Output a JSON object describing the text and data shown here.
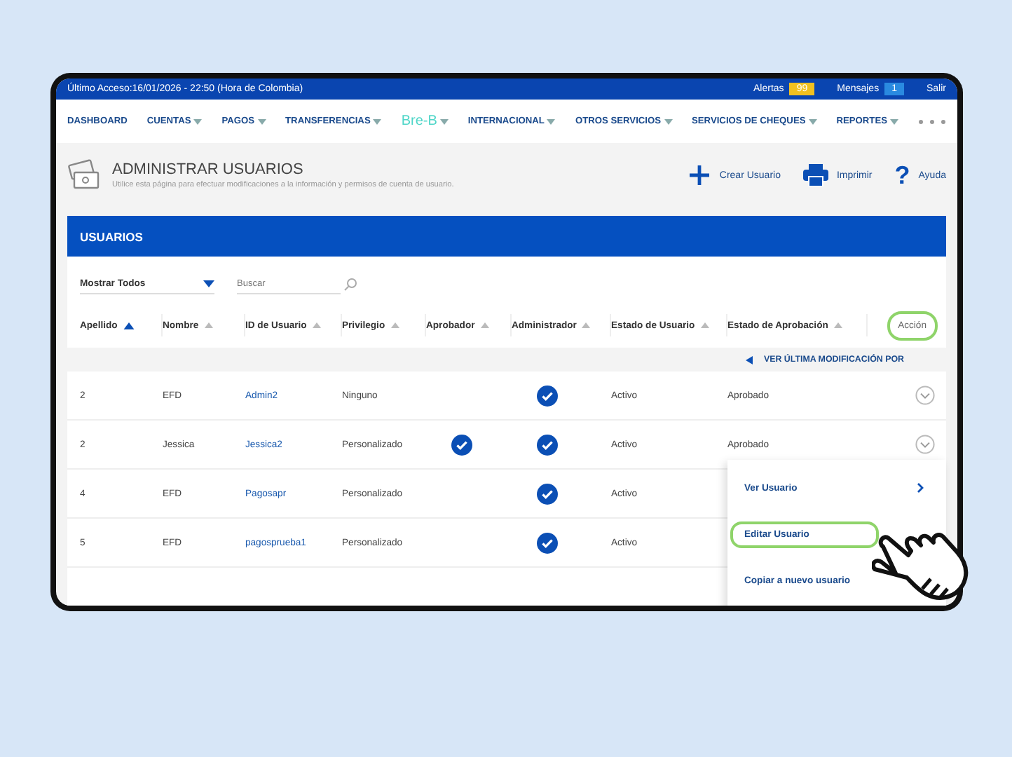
{
  "top_bar": {
    "last_access": "Último Acceso:16/01/2026 - 22:50 (Hora de Colombia)",
    "alerts": {
      "label": "Alertas",
      "count": "99"
    },
    "messages": {
      "label": "Mensajes",
      "count": "1"
    },
    "logout": "Salir"
  },
  "nav": [
    {
      "label": "DASHBOARD",
      "kind": "text",
      "dropdown": false
    },
    {
      "label": "CUENTAS",
      "kind": "text",
      "dropdown": true
    },
    {
      "label": "PAGOS",
      "kind": "text",
      "dropdown": true
    },
    {
      "label": "TRANSFERENCIAS",
      "kind": "text",
      "dropdown": true
    },
    {
      "label": "Bre-B",
      "kind": "logo",
      "dropdown": true
    },
    {
      "label": "INTERNACIONAL",
      "kind": "text",
      "dropdown": true
    },
    {
      "label": "OTROS SERVICIOS",
      "kind": "text",
      "dropdown": true
    },
    {
      "label": "SERVICIOS DE CHEQUES",
      "kind": "text",
      "dropdown": true
    },
    {
      "label": "REPORTES",
      "kind": "text",
      "dropdown": true
    }
  ],
  "page_header": {
    "title": "ADMINISTRAR USUARIOS",
    "subtitle": "Utilice esta página para efectuar modificaciones a la información y permisos de cuenta de usuario.",
    "actions": [
      {
        "label": "Crear Usuario",
        "kind": "add"
      },
      {
        "label": "Imprimir",
        "kind": "print"
      },
      {
        "label": "Ayuda",
        "kind": "help",
        "icon": "?"
      }
    ]
  },
  "panel": {
    "title": "USUARIOS",
    "filter": "Mostrar Todos",
    "search": {
      "placeholder": "Buscar"
    },
    "columns": [
      {
        "label": "Apellido",
        "kind": "sortable",
        "sorted": true
      },
      {
        "label": "Nombre",
        "kind": "sortable",
        "sorted": false
      },
      {
        "label": "ID de Usuario",
        "kind": "sortable",
        "sorted": false
      },
      {
        "label": "Privilegio",
        "kind": "sortable",
        "sorted": false
      },
      {
        "label": "Aprobador",
        "kind": "sortable",
        "sorted": false
      },
      {
        "label": "Administrador",
        "kind": "sortable",
        "sorted": false
      },
      {
        "label": "Estado de Usuario",
        "kind": "sortable",
        "sorted": false
      },
      {
        "label": "Estado de Aprobación",
        "kind": "sortable",
        "sorted": false
      },
      {
        "label": "Acción",
        "kind": "action",
        "highlighted": true
      }
    ],
    "last_modified_link": "VER ÚLTIMA MODIFICACIÓN POR",
    "rows": [
      {
        "apellido": "2",
        "nombre": "EFD",
        "id": "Admin2",
        "privilegio": "Ninguno",
        "aprobador": false,
        "administrador": true,
        "estado": "Activo",
        "aprobacion": "Aprobado"
      },
      {
        "apellido": "2",
        "nombre": "Jessica",
        "id": "Jessica2",
        "privilegio": "Personalizado",
        "aprobador": true,
        "administrador": true,
        "estado": "Activo",
        "aprobacion": "Aprobado",
        "action_menu": [
          {
            "label": "Ver Usuario",
            "arrow": true,
            "selected": false
          },
          {
            "label": "Editar Usuario",
            "arrow": false,
            "selected": true
          },
          {
            "label": "Copiar a nuevo usuario",
            "arrow": false,
            "selected": false
          }
        ]
      },
      {
        "apellido": "4",
        "nombre": "EFD",
        "id": "Pagosapr",
        "privilegio": "Personalizado",
        "aprobador": false,
        "administrador": true,
        "estado": "Activo"
      },
      {
        "apellido": "5",
        "nombre": "EFD",
        "id": "pagosprueba1",
        "privilegio": "Personalizado",
        "aprobador": false,
        "administrador": true,
        "estado": "Activo"
      }
    ]
  }
}
